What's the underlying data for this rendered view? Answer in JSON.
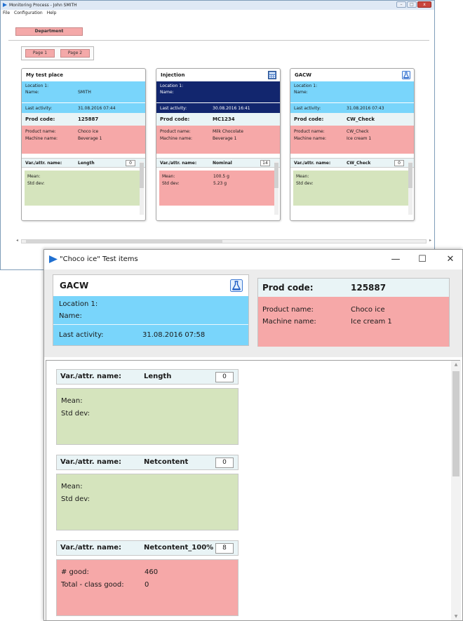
{
  "bg_window": {
    "title": "Monitoring Process - John SMITH",
    "menu": [
      "File",
      "Configuration",
      "Help"
    ],
    "department_label": "Department",
    "pages": [
      "Page 1",
      "Page 2"
    ],
    "cards": [
      {
        "title": "My test place",
        "location_label": "Location 1:",
        "name_label": "Name:",
        "name_value": "SMITH",
        "last_activity_label": "Last activity:",
        "last_activity_value": "31.08.2016 07:44",
        "prod_code_label": "Prod code:",
        "prod_code_value": "125887",
        "product_name_label": "Product name:",
        "product_name_value": "Choco ice",
        "machine_name_label": "Machine name:",
        "machine_name_value": "Beverage 1",
        "var_label": "Var./attr. name:",
        "var_value": "Length",
        "count": "0",
        "stat1_label": "Mean:",
        "stat1_value": "",
        "stat2_label": "Std dev:",
        "stat2_value": ""
      },
      {
        "title": "Injection",
        "location_label": "Location 1:",
        "name_label": "Name:",
        "name_value": "",
        "last_activity_label": "Last activity:",
        "last_activity_value": "30.08.2016 16:41",
        "prod_code_label": "Prod code:",
        "prod_code_value": "MC1234",
        "product_name_label": "Product name:",
        "product_name_value": "Milk Chocolate",
        "machine_name_label": "Machine name:",
        "machine_name_value": "Beverage 1",
        "var_label": "Var./attr. name:",
        "var_value": "Nominal",
        "count": "14",
        "stat1_label": "Mean:",
        "stat1_value": "100.5 g",
        "stat2_label": "Std dev:",
        "stat2_value": "5.23 g"
      },
      {
        "title": "GACW",
        "location_label": "Location 1:",
        "name_label": "Name:",
        "name_value": "",
        "last_activity_label": "Last activity:",
        "last_activity_value": "31.08.2016 07:43",
        "prod_code_label": "Prod code:",
        "prod_code_value": "CW_Check",
        "product_name_label": "Product name:",
        "product_name_value": "CW_Check",
        "machine_name_label": "Machine name:",
        "machine_name_value": "Ice cream 1",
        "var_label": "Var./attr. name:",
        "var_value": "CW_Check",
        "count": "0",
        "stat1_label": "Mean:",
        "stat1_value": "",
        "stat2_label": "Std dev:",
        "stat2_value": ""
      }
    ]
  },
  "dialog": {
    "title": "\"Choco ice\" Test items",
    "minimize": "—",
    "maximize": "☐",
    "close": "✕",
    "station": {
      "title": "GACW",
      "location_label": "Location 1:",
      "name_label": "Name:",
      "last_activity_label": "Last activity:",
      "last_activity_value": "31.08.2016 07:58"
    },
    "product": {
      "prod_code_label": "Prod code:",
      "prod_code_value": "125887",
      "product_name_label": "Product name:",
      "product_name_value": "Choco ice",
      "machine_name_label": "Machine name:",
      "machine_name_value": "Ice cream 1"
    },
    "variables": [
      {
        "label": "Var./attr. name:",
        "name": "Length",
        "count": "0",
        "stat1_label": "Mean:",
        "stat1_value": "",
        "stat2_label": "Std dev:",
        "stat2_value": ""
      },
      {
        "label": "Var./attr. name:",
        "name": "Netcontent",
        "count": "0",
        "stat1_label": "Mean:",
        "stat1_value": "",
        "stat2_label": "Std dev:",
        "stat2_value": ""
      },
      {
        "label": "Var./attr. name:",
        "name": "Netcontent_100%",
        "count": "8",
        "stat1_label": "# good:",
        "stat1_value": "460",
        "stat2_label": "Total - class good:",
        "stat2_value": "0"
      }
    ]
  },
  "colors": {
    "location_blue": "#79d5fb",
    "selected_navy": "#12266e",
    "status_green": "#d5e4bd",
    "status_red": "#f6a8a8"
  },
  "icons": [
    "app-icon",
    "flask-icon",
    "calculator-icon"
  ]
}
